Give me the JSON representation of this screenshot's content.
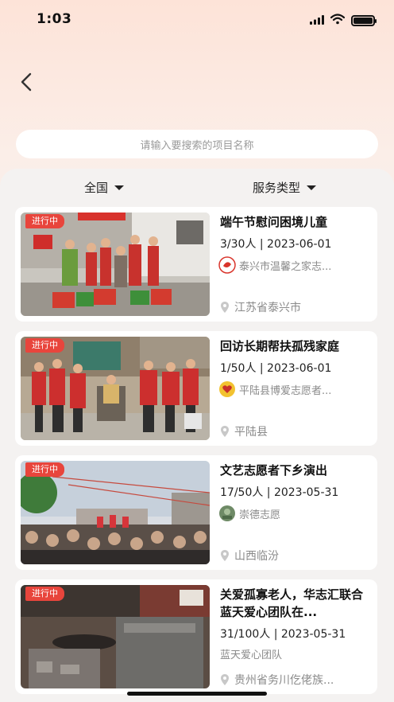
{
  "status_bar": {
    "time": "1:03"
  },
  "search": {
    "placeholder": "请输入要搜索的项目名称"
  },
  "filters": {
    "region": "全国",
    "service_type": "服务类型"
  },
  "projects": [
    {
      "status": "进行中",
      "title": "端午节慰问困境儿童",
      "count_date": "3/30人 | 2023-06-01",
      "org": "泰兴市温馨之家志...",
      "location": "江苏省泰兴市",
      "logo_icon": "red-swirl-logo"
    },
    {
      "status": "进行中",
      "title": "回访长期帮扶孤残家庭",
      "count_date": "1/50人 | 2023-06-01",
      "org": "平陆县博爱志愿者...",
      "location": "平陆县",
      "logo_icon": "yellow-heart-logo"
    },
    {
      "status": "进行中",
      "title": "文艺志愿者下乡演出",
      "count_date": "17/50人 | 2023-05-31",
      "org": "崇德志愿",
      "location": "山西临汾",
      "logo_icon": "green-photo-logo"
    },
    {
      "status": "进行中",
      "title": "关爱孤寡老人，华志汇联合蓝天爱心团队在...",
      "count_date": "31/100人 | 2023-05-31",
      "org": "蓝天爱心团队",
      "location": "贵州省务川仡佬族...",
      "logo_icon": ""
    }
  ]
}
